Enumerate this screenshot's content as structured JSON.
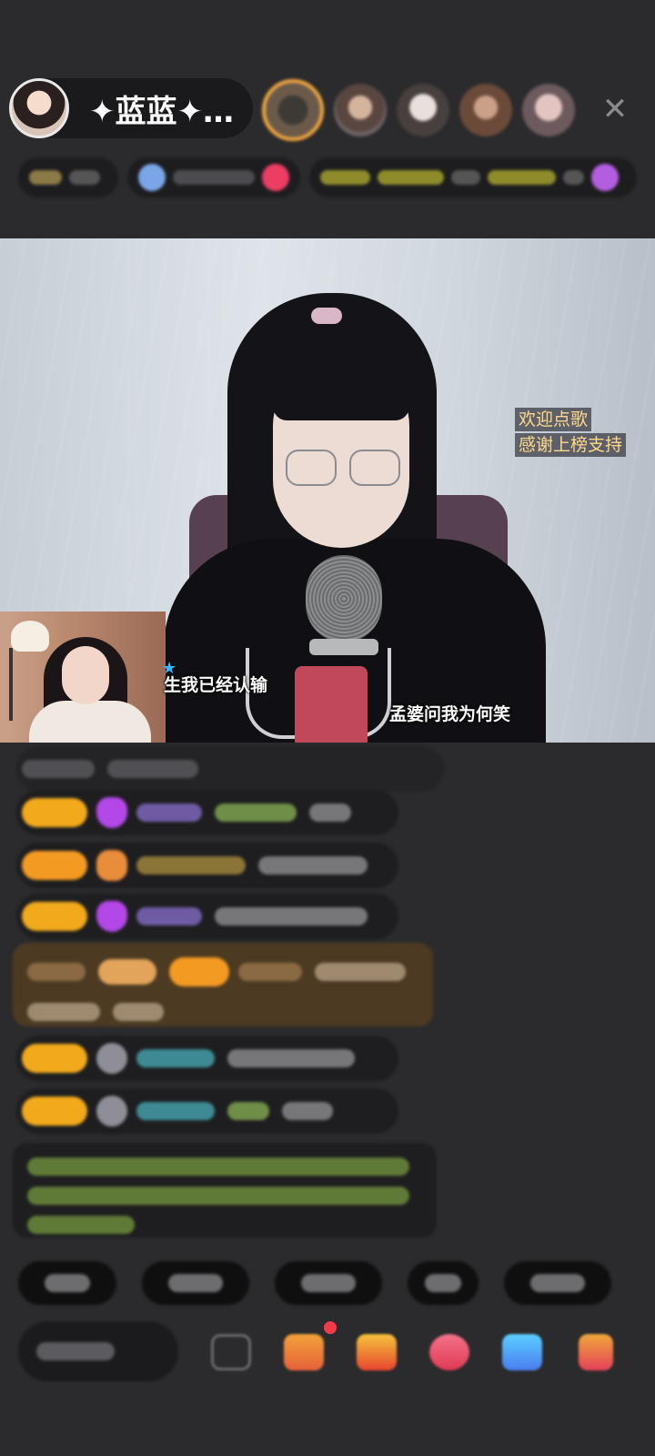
{
  "host": {
    "name": "✦蓝蓝✦…",
    "avatar_icon": "host-avatar"
  },
  "top_bar": {
    "viewer_count_icons": 5,
    "close_icon": "close-icon",
    "close_glyph": "✕"
  },
  "video": {
    "overlay_tags": [
      "欢迎点歌",
      "感谢上榜支持"
    ],
    "lyrics": {
      "left": "生我已经认输",
      "right": "孟婆问我为何笑"
    }
  },
  "colors": {
    "background": "#2b2b2d",
    "badge_gold": "#f2a91c",
    "overlay_text": "#ffd98a",
    "accent_red": "#f23b47"
  }
}
